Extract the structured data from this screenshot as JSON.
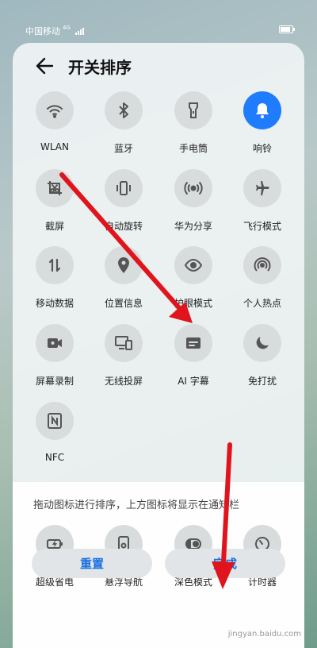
{
  "status_bar": {
    "carrier": "中国移动",
    "network": "4G"
  },
  "header": {
    "title": "开关排序"
  },
  "tiles": [
    {
      "label": "WLAN",
      "icon": "wifi-icon",
      "active": false
    },
    {
      "label": "蓝牙",
      "icon": "bluetooth-icon",
      "active": false
    },
    {
      "label": "手电筒",
      "icon": "flashlight-icon",
      "active": false
    },
    {
      "label": "响铃",
      "icon": "bell-icon",
      "active": true
    },
    {
      "label": "截屏",
      "icon": "screenshot-icon",
      "active": false
    },
    {
      "label": "自动旋转",
      "icon": "auto-rotate-icon",
      "active": false
    },
    {
      "label": "华为分享",
      "icon": "share-icon",
      "active": false
    },
    {
      "label": "飞行模式",
      "icon": "airplane-icon",
      "active": false
    },
    {
      "label": "移动数据",
      "icon": "mobile-data-icon",
      "active": false
    },
    {
      "label": "位置信息",
      "icon": "location-icon",
      "active": false
    },
    {
      "label": "护眼模式",
      "icon": "eye-icon",
      "active": false
    },
    {
      "label": "个人热点",
      "icon": "hotspot-icon",
      "active": false
    },
    {
      "label": "屏幕录制",
      "icon": "screen-record-icon",
      "active": false
    },
    {
      "label": "无线投屏",
      "icon": "cast-icon",
      "active": false
    },
    {
      "label": "AI 字幕",
      "icon": "subtitle-icon",
      "active": false
    },
    {
      "label": "免打扰",
      "icon": "moon-icon",
      "active": false
    },
    {
      "label": "NFC",
      "icon": "nfc-icon",
      "active": false
    }
  ],
  "hint": "拖动图标进行排序，上方图标将显示在通知栏",
  "lower_tiles": [
    {
      "label": "超级省电",
      "icon": "battery-saver-icon"
    },
    {
      "label": "悬浮导航",
      "icon": "floating-nav-icon"
    },
    {
      "label": "深色模式",
      "icon": "dark-mode-icon"
    },
    {
      "label": "计时器",
      "icon": "timer-icon"
    }
  ],
  "buttons": {
    "reset": "重置",
    "done": "完成"
  },
  "colors": {
    "accent": "#1f7cff",
    "button_text": "#1a6fe0",
    "annotation_arrow": "#e0141d"
  },
  "watermark": "jingyan.baidu.com"
}
